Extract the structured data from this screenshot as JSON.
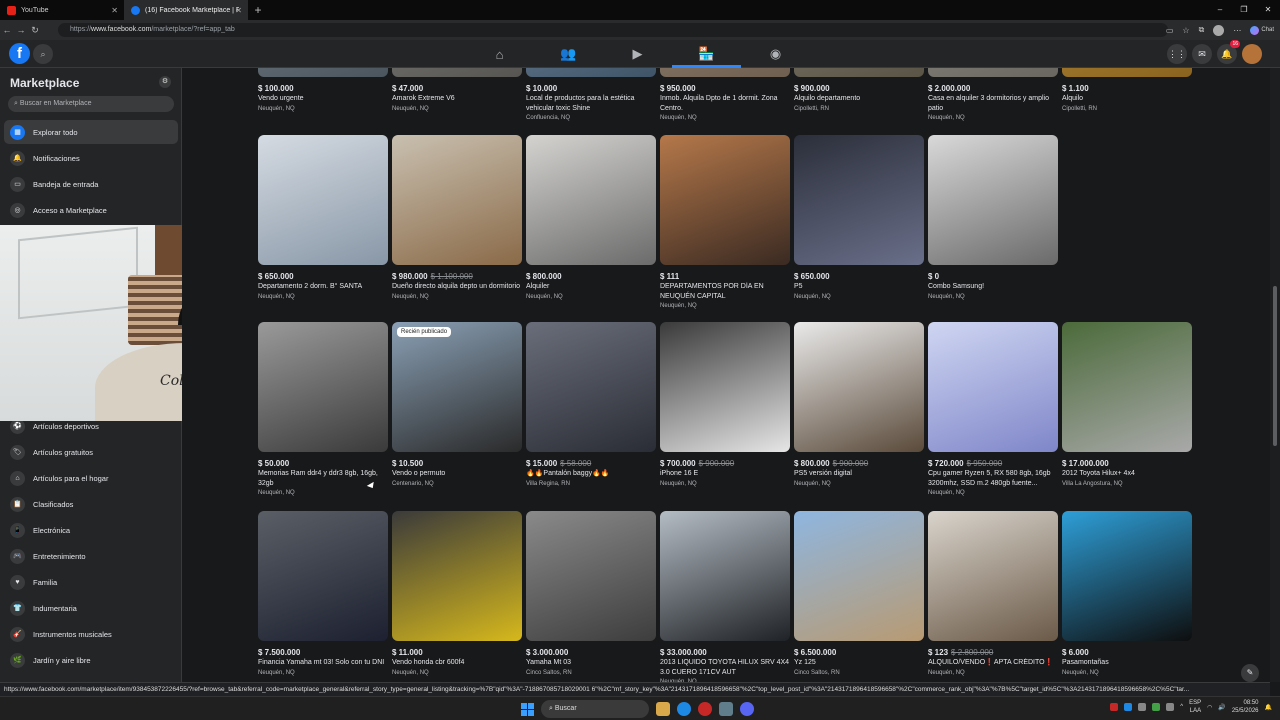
{
  "browser": {
    "tabs": [
      {
        "title": "YouTube",
        "active": false
      },
      {
        "title": "(16) Facebook Marketplace | Faceb",
        "active": true
      }
    ],
    "new_tab": "+",
    "url_prefix": "https://",
    "url_host": "www.facebook.com",
    "url_path": "/marketplace/?ref=app_tab",
    "copilot": "Chat",
    "window_controls": [
      "–",
      "❐",
      "✕"
    ]
  },
  "header": {
    "logo": "f",
    "nav": [
      {
        "icon": "home-icon",
        "glyph": "⌂"
      },
      {
        "icon": "friends-icon",
        "glyph": "👥"
      },
      {
        "icon": "video-icon",
        "glyph": "▶"
      },
      {
        "icon": "marketplace-icon",
        "glyph": "🏪",
        "active": true
      },
      {
        "icon": "groups-icon",
        "glyph": "◉"
      }
    ],
    "notif_count": "16"
  },
  "sidebar": {
    "title": "Marketplace",
    "search_placeholder": "Buscar en Marketplace",
    "items": [
      {
        "label": "Explorar todo",
        "icon": "storefront-icon",
        "glyph": "▦",
        "active": true
      },
      {
        "label": "Notificaciones",
        "icon": "bell-icon",
        "glyph": "🔔"
      },
      {
        "label": "Bandeja de entrada",
        "icon": "inbox-icon",
        "glyph": "▭"
      },
      {
        "label": "Acceso a Marketplace",
        "icon": "marketplace-access-icon",
        "glyph": "◎"
      },
      {
        "label": "Artículos deportivos",
        "icon": "sports-icon",
        "glyph": "⚽"
      },
      {
        "label": "Artículos gratuitos",
        "icon": "free-items-icon",
        "glyph": "🏷"
      },
      {
        "label": "Artículos para el hogar",
        "icon": "home-goods-icon",
        "glyph": "⌂"
      },
      {
        "label": "Clasificados",
        "icon": "classifieds-icon",
        "glyph": "📋"
      },
      {
        "label": "Electrónica",
        "icon": "electronics-icon",
        "glyph": "📱"
      },
      {
        "label": "Entretenimiento",
        "icon": "entertainment-icon",
        "glyph": "🎮"
      },
      {
        "label": "Familia",
        "icon": "family-icon",
        "glyph": "♥"
      },
      {
        "label": "Indumentaria",
        "icon": "clothing-icon",
        "glyph": "👕"
      },
      {
        "label": "Instrumentos musicales",
        "icon": "music-icon",
        "glyph": "🎸"
      },
      {
        "label": "Jardín y aire libre",
        "icon": "garden-icon",
        "glyph": "🌿"
      }
    ]
  },
  "rows": [
    [
      {
        "price": "$ 100.000",
        "old": "",
        "title": "Vendo urgente",
        "loc": "Neuquén, NQ",
        "c1": "#7d8a93",
        "c2": "#4b555d"
      },
      {
        "price": "$ 47.000",
        "old": "",
        "title": "Amarok Extreme V6",
        "loc": "Neuquén, NQ",
        "c1": "#8b8b88",
        "c2": "#565552"
      },
      {
        "price": "$ 10.000",
        "old": "",
        "title": "Local de productos para la estética vehicular toxic Shine",
        "loc": "Confluencia, NQ",
        "c1": "#7d94a8",
        "c2": "#405468"
      },
      {
        "price": "$ 950.000",
        "old": "",
        "title": "Inmob. Alquila Dpto de 1 dormit. Zona Centro.",
        "loc": "Neuquén, NQ",
        "c1": "#9c8c7c",
        "c2": "#6e5f50"
      },
      {
        "price": "$ 900.000",
        "old": "",
        "title": "Alquilo departamento",
        "loc": "Cipolletti, RN",
        "c1": "#8a8476",
        "c2": "#5a5446"
      },
      {
        "price": "$ 2.000.000",
        "old": "",
        "title": "Casa en alquiler 3 dormitorios y amplio patio",
        "loc": "Neuquén, NQ",
        "c1": "#9a9690",
        "c2": "#6a6660"
      },
      {
        "price": "$ 1.100",
        "old": "",
        "title": "Alquilo",
        "loc": "Cipolletti, RN",
        "c1": "#c0903a",
        "c2": "#8a6420"
      }
    ],
    [
      {
        "price": "$ 650.000",
        "old": "",
        "title": "Departamento 2 dorm. B° SANTA",
        "loc": "Neuquén, NQ",
        "c1": "#d5dbe2",
        "c2": "#8897a7"
      },
      {
        "price": "$ 980.000",
        "old": "$ 1.100.000",
        "title": "Dueño directo alquila depto un dormitorio",
        "loc": "Neuquén, NQ",
        "c1": "#c9c0b0",
        "c2": "#8a6a48"
      },
      {
        "price": "$ 800.000",
        "old": "",
        "title": "Alquiler",
        "loc": "Neuquén, NQ",
        "c1": "#d4d3d0",
        "c2": "#6b6b6b"
      },
      {
        "price": "$ 111",
        "old": "",
        "title": "DEPARTAMENTOS POR DÍA EN NEUQUÉN CAPITAL",
        "loc": "Neuquén, NQ",
        "c1": "#b5784a",
        "c2": "#3a2a22"
      },
      {
        "price": "$ 650.000",
        "old": "",
        "title": "P5",
        "loc": "Neuquén, NQ",
        "c1": "#2b2f3a",
        "c2": "#6a6f8a"
      },
      {
        "price": "$ 0",
        "old": "",
        "title": "Combo Samsung!",
        "loc": "Neuquén, NQ",
        "c1": "#d9d9d9",
        "c2": "#6a6a6a"
      }
    ],
    [
      {
        "price": "$ 50.000",
        "old": "",
        "title": "Memorias Ram ddr4 y ddr3 8gb, 16gb, 32gb",
        "loc": "Neuquén, NQ",
        "c1": "#9a9a9a",
        "c2": "#3a3a3a",
        "badge": ""
      },
      {
        "price": "$ 10.500",
        "old": "",
        "title": "Vendo o permuto",
        "loc": "Centenario, NQ",
        "c1": "#8aa0b5",
        "c2": "#2a2a2a",
        "badge": "Recién publicado"
      },
      {
        "price": "$ 15.000",
        "old": "$ 58.000",
        "title": "🔥🔥Pantalón baggy🔥🔥",
        "loc": "Villa Regina, RN",
        "c1": "#6a6e7a",
        "c2": "#2a2d35",
        "badge": ""
      },
      {
        "price": "$ 700.000",
        "old": "$ 900.000",
        "title": "iPhone 16 E",
        "loc": "Neuquén, NQ",
        "c1": "#3a3a3a",
        "c2": "#e6e6e6",
        "badge": ""
      },
      {
        "price": "$ 800.000",
        "old": "$ 900.000",
        "title": "PS5 versión digital",
        "loc": "Neuquén, NQ",
        "c1": "#eaeaea",
        "c2": "#5a4a3a",
        "badge": ""
      },
      {
        "price": "$ 720.000",
        "old": "$ 950.000",
        "title": "Cpu gamer Ryzen 5, RX 580 8gb, 16gb 3200mhz, SSD m.2 480gb fuente...",
        "loc": "Neuquén, NQ",
        "c1": "#cfd6f2",
        "c2": "#7f86c9",
        "badge": ""
      },
      {
        "price": "$ 17.000.000",
        "old": "",
        "title": "2012 Toyota Hilux+ 4x4",
        "loc": "Villa La Angostura, NQ",
        "c1": "#4b6a3a",
        "c2": "#a9a9a9",
        "badge": ""
      }
    ],
    [
      {
        "price": "$ 7.500.000",
        "old": "",
        "title": "Financia Yamaha mt 03! Solo con tu DNI",
        "loc": "Neuquén, NQ",
        "c1": "#5a5f66",
        "c2": "#1c2030"
      },
      {
        "price": "$ 11.000",
        "old": "",
        "title": "Vendo honda cbr 600f4",
        "loc": "Neuquén, NQ",
        "c1": "#3a3a3a",
        "c2": "#d6b81c"
      },
      {
        "price": "$ 3.000.000",
        "old": "",
        "title": "Yamaha Mt 03",
        "loc": "Cinco Saltos, RN",
        "c1": "#8a8a8a",
        "c2": "#3d3d3d"
      },
      {
        "price": "$ 33.000.000",
        "old": "",
        "title": "2013 LIQUIDO TOYOTA HILUX SRV 4X4 3.0 CUERO 171CV AUT",
        "loc": "Neuquén, NQ",
        "c1": "#b4bcc4",
        "c2": "#1f2226"
      },
      {
        "price": "$ 6.500.000",
        "old": "",
        "title": "Yz 125",
        "loc": "Cinco Saltos, RN",
        "c1": "#8fb6e0",
        "c2": "#b89a72"
      },
      {
        "price": "$ 123",
        "old": "$ 2.800.000",
        "title": "ALQUILO/VENDO❗APTA CRÉDITO❗",
        "loc": "Neuquén, NQ",
        "c1": "#d9d4cc",
        "c2": "#6b5a48"
      },
      {
        "price": "$ 6.000",
        "old": "",
        "title": "Pasamontañas",
        "loc": "Neuquén, NQ",
        "c1": "#2e9fd8",
        "c2": "#0e0e0e"
      }
    ]
  ],
  "status_url": "https://www.facebook.com/marketplace/item/938453872226455/?ref=browse_tab&referral_code=marketplace_general&referral_story_type=general_listing&tracking=%7B\"qid\"%3A\"-718867085718029001 6\"%2C\"mf_story_key\"%3A\"2143171896418596658\"%2C\"top_level_post_id\"%3A\"2143171896418596658\"%2C\"commerce_rank_obj\"%3A\"%7B%5C\"target_id%5C\"%3A2143171896418596658%2C%5C\"tar...",
  "taskbar": {
    "search": "Buscar",
    "lang1": "ESP",
    "lang2": "LAA",
    "time": "08:50",
    "date": "25/5/2026"
  }
}
